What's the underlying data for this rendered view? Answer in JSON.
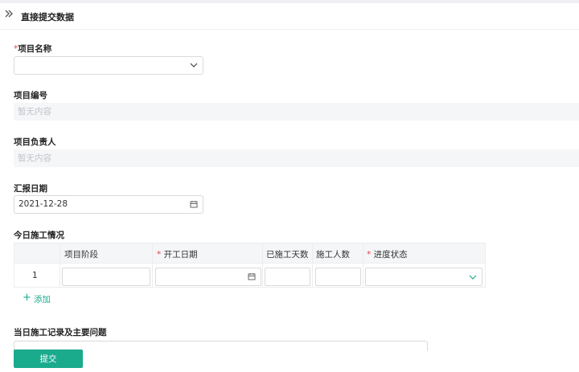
{
  "header": {
    "title": "直接提交数据",
    "expand_icon": "double-chevron-right-icon"
  },
  "form": {
    "project_name": {
      "label": "项目名称",
      "required_mark": "*",
      "value": ""
    },
    "project_code": {
      "label": "项目编号",
      "placeholder": "暂无内容"
    },
    "project_lead": {
      "label": "项目负责人",
      "placeholder": "暂无内容"
    },
    "report_date": {
      "label": "汇报日期",
      "value": "2021-12-28"
    },
    "today_progress": {
      "label": "今日施工情况",
      "columns": [
        {
          "label": "项目阶段",
          "required": false
        },
        {
          "label": "开工日期",
          "required": true
        },
        {
          "label": "已施工天数",
          "required": false
        },
        {
          "label": "施工人数",
          "required": false
        },
        {
          "label": "进度状态",
          "required": true
        }
      ],
      "required_mark": "*",
      "rows": [
        {
          "index": "1"
        }
      ],
      "add_label": "添加",
      "add_icon": "+"
    },
    "records": {
      "label": "当日施工记录及主要问题"
    }
  },
  "submit_label": "提交",
  "colors": {
    "accent": "#1aaa8c",
    "required": "#e5484d"
  }
}
